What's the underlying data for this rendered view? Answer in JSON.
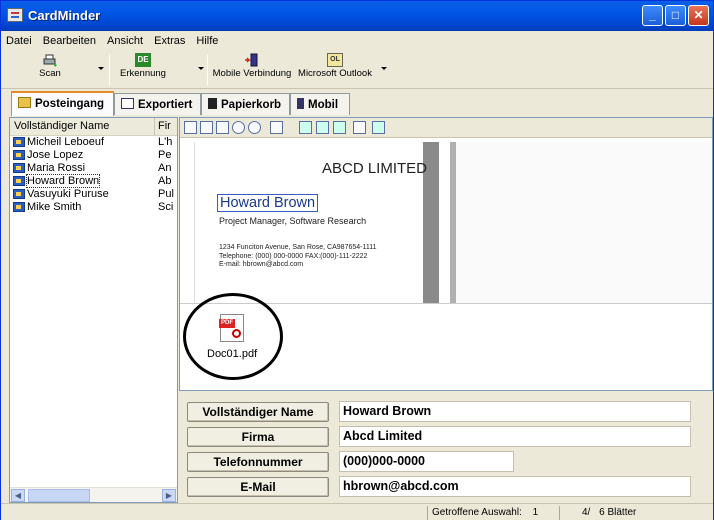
{
  "window": {
    "title": "CardMinder"
  },
  "menu": [
    "Datei",
    "Bearbeiten",
    "Ansicht",
    "Extras",
    "Hilfe"
  ],
  "toolbar": {
    "scan": "Scan",
    "recognition_badge": "DE",
    "recognition": "Erkennung",
    "mobile": "Mobile Verbindung",
    "outlook_badge": "OL",
    "outlook": "Microsoft Outlook"
  },
  "tabs": [
    {
      "label": "Posteingang"
    },
    {
      "label": "Exportiert"
    },
    {
      "label": "Papierkorb"
    },
    {
      "label": "Mobil"
    }
  ],
  "list": {
    "columns": [
      "Vollständiger Name",
      "Fir"
    ],
    "rows": [
      {
        "name": "Micheil Leboeuf",
        "firm": "L'h"
      },
      {
        "name": "Jose Lopez",
        "firm": "Pe"
      },
      {
        "name": "Maria Rossi",
        "firm": "An"
      },
      {
        "name": "Howard Brown",
        "firm": "Ab"
      },
      {
        "name": "Vasuyuki Puruse",
        "firm": "Pul"
      },
      {
        "name": "Mike Smith",
        "firm": "Sci"
      }
    ],
    "selected_index": 3
  },
  "card": {
    "company": "ABCD LIMITED",
    "name": "Howard Brown",
    "title": "Project Manager, Software Research",
    "address_lines": [
      "1234 Funciton Avenue, San Rose, CA987654-1111",
      "Telephone: (000) 000-0000  FAX:(000)-111-2222",
      "E-mail: hbrown@abcd.com"
    ]
  },
  "attachment": {
    "filename": "Doc01.pdf",
    "icon_label": "PDF"
  },
  "fields": [
    {
      "label": "Vollständiger Name",
      "value": "Howard Brown"
    },
    {
      "label": "Firma",
      "value": "Abcd Limited"
    },
    {
      "label": "Telefonnummer",
      "value": "(000)000-0000"
    },
    {
      "label": "E-Mail",
      "value": "hbrown@abcd.com"
    }
  ],
  "status": {
    "hits": "Getroffene Auswahl:",
    "hits_count": "1",
    "page": "4/",
    "sheets": "6 Blätter"
  },
  "colors": {
    "titlebar": "#0054e3",
    "accent_tab": "#e68b2c",
    "selection_text": "#1a3a8a"
  }
}
